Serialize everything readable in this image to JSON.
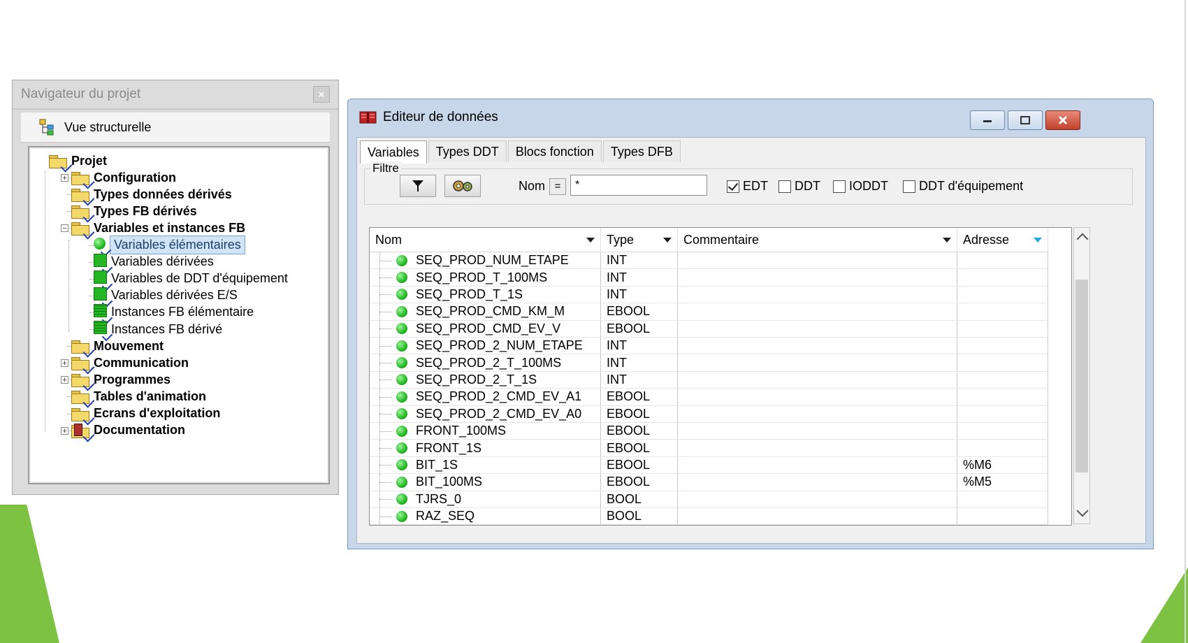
{
  "navigator": {
    "title": "Navigateur du projet",
    "close_label": "×",
    "view_label": "Vue structurelle",
    "tree": [
      {
        "label": "Projet",
        "bold": true,
        "icon": "folder-open-icon"
      },
      {
        "label": "Configuration",
        "bold": true,
        "icon": "folder-icon",
        "expander": "+"
      },
      {
        "label": "Types données dérivés",
        "bold": true,
        "icon": "folder-icon"
      },
      {
        "label": "Types FB dérivés",
        "bold": true,
        "icon": "folder-icon"
      },
      {
        "label": "Variables et instances FB",
        "bold": true,
        "icon": "folder-open-icon",
        "expander": "−"
      },
      {
        "label": "Variables élémentaires",
        "bold": false,
        "icon": "green-ball-icon",
        "selected": true
      },
      {
        "label": "Variables dérivées",
        "bold": false,
        "icon": "green-block-icon"
      },
      {
        "label": "Variables de DDT d'équipement",
        "bold": false,
        "icon": "green-block-icon"
      },
      {
        "label": "Variables dérivées E/S",
        "bold": false,
        "icon": "green-block-io-icon"
      },
      {
        "label": "Instances FB élémentaire",
        "bold": false,
        "icon": "fb-instance-icon"
      },
      {
        "label": "Instances FB dérivé",
        "bold": false,
        "icon": "fb-instance-icon"
      },
      {
        "label": "Mouvement",
        "bold": true,
        "icon": "folder-icon"
      },
      {
        "label": "Communication",
        "bold": true,
        "icon": "folder-icon",
        "expander": "+"
      },
      {
        "label": "Programmes",
        "bold": true,
        "icon": "folder-icon",
        "expander": "+"
      },
      {
        "label": "Tables d'animation",
        "bold": true,
        "icon": "folder-icon"
      },
      {
        "label": "Ecrans d'exploitation",
        "bold": true,
        "icon": "folder-icon"
      },
      {
        "label": "Documentation",
        "bold": true,
        "icon": "documentation-icon",
        "expander": "+"
      }
    ]
  },
  "editor": {
    "title": "Editeur de données",
    "tabs": [
      "Variables",
      "Types DDT",
      "Blocs fonction",
      "Types DFB"
    ],
    "filter": {
      "legend": "Filtre",
      "nom_label": "Nom",
      "eq_label": "=",
      "nom_value": "*",
      "checkboxes": [
        {
          "label": "EDT",
          "checked": true
        },
        {
          "label": "DDT",
          "checked": false
        },
        {
          "label": "IODDT",
          "checked": false
        },
        {
          "label": "DDT d'équipement",
          "checked": false
        }
      ]
    },
    "columns": [
      "Nom",
      "Type",
      "Commentaire",
      "Adresse"
    ],
    "rows": [
      {
        "name": "SEQ_PROD_NUM_ETAPE",
        "type": "INT",
        "comment": "",
        "address": ""
      },
      {
        "name": "SEQ_PROD_T_100MS",
        "type": "INT",
        "comment": "",
        "address": ""
      },
      {
        "name": "SEQ_PROD_T_1S",
        "type": "INT",
        "comment": "",
        "address": ""
      },
      {
        "name": "SEQ_PROD_CMD_KM_M",
        "type": "EBOOL",
        "comment": "",
        "address": ""
      },
      {
        "name": "SEQ_PROD_CMD_EV_V",
        "type": "EBOOL",
        "comment": "",
        "address": ""
      },
      {
        "name": "SEQ_PROD_2_NUM_ETAPE",
        "type": "INT",
        "comment": "",
        "address": ""
      },
      {
        "name": "SEQ_PROD_2_T_100MS",
        "type": "INT",
        "comment": "",
        "address": ""
      },
      {
        "name": "SEQ_PROD_2_T_1S",
        "type": "INT",
        "comment": "",
        "address": ""
      },
      {
        "name": "SEQ_PROD_2_CMD_EV_A1",
        "type": "EBOOL",
        "comment": "",
        "address": ""
      },
      {
        "name": "SEQ_PROD_2_CMD_EV_A0",
        "type": "EBOOL",
        "comment": "",
        "address": ""
      },
      {
        "name": "FRONT_100MS",
        "type": "EBOOL",
        "comment": "",
        "address": ""
      },
      {
        "name": "FRONT_1S",
        "type": "EBOOL",
        "comment": "",
        "address": ""
      },
      {
        "name": "BIT_1S",
        "type": "EBOOL",
        "comment": "",
        "address": "%M6"
      },
      {
        "name": "BIT_100MS",
        "type": "EBOOL",
        "comment": "",
        "address": "%M5"
      },
      {
        "name": "TJRS_0",
        "type": "BOOL",
        "comment": "",
        "address": ""
      },
      {
        "name": "RAZ_SEQ",
        "type": "BOOL",
        "comment": "",
        "address": ""
      }
    ]
  },
  "colors": {
    "accent_green": "#7dc242",
    "selection": "#cfe4f6",
    "window_frame": "#c7d6e9"
  }
}
